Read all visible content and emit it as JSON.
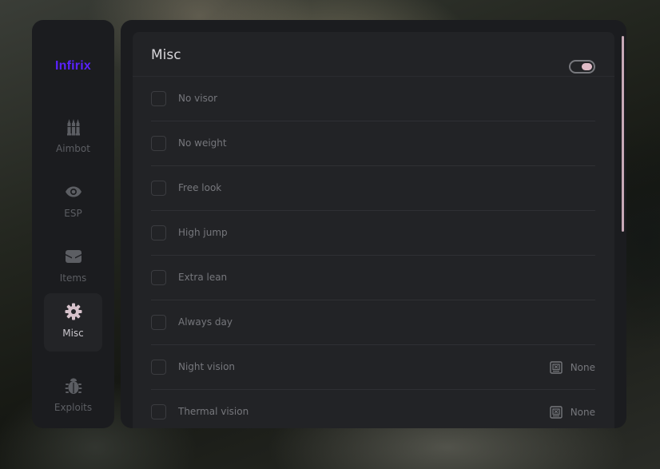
{
  "app": {
    "brand": "Infirix"
  },
  "sidebar": {
    "items": [
      {
        "label": "Aimbot",
        "icon": "bullets-icon",
        "active": false
      },
      {
        "label": "ESP",
        "icon": "eye-icon",
        "active": false
      },
      {
        "label": "Items",
        "icon": "wallet-icon",
        "active": false
      },
      {
        "label": "Misc",
        "icon": "gear-icon",
        "active": true
      },
      {
        "label": "Exploits",
        "icon": "bug-icon",
        "active": false
      }
    ]
  },
  "main": {
    "title": "Misc",
    "enabled": true,
    "options": [
      {
        "label": "No visor",
        "checked": false
      },
      {
        "label": "No weight",
        "checked": false
      },
      {
        "label": "Free look",
        "checked": false
      },
      {
        "label": "High jump",
        "checked": false
      },
      {
        "label": "Extra lean",
        "checked": false
      },
      {
        "label": "Always day",
        "checked": false
      },
      {
        "label": "Night vision",
        "checked": false,
        "keybind": "None",
        "keybind_icon": "keyboard-key-icon"
      },
      {
        "label": "Thermal vision",
        "checked": false,
        "keybind": "None",
        "keybind_icon": "keyboard-key-icon"
      }
    ]
  },
  "colors": {
    "brand": "#5a22ff",
    "accent": "#e0bcc8",
    "panel": "#1b1c1f",
    "card": "#222326",
    "muted_text": "#76777c"
  }
}
